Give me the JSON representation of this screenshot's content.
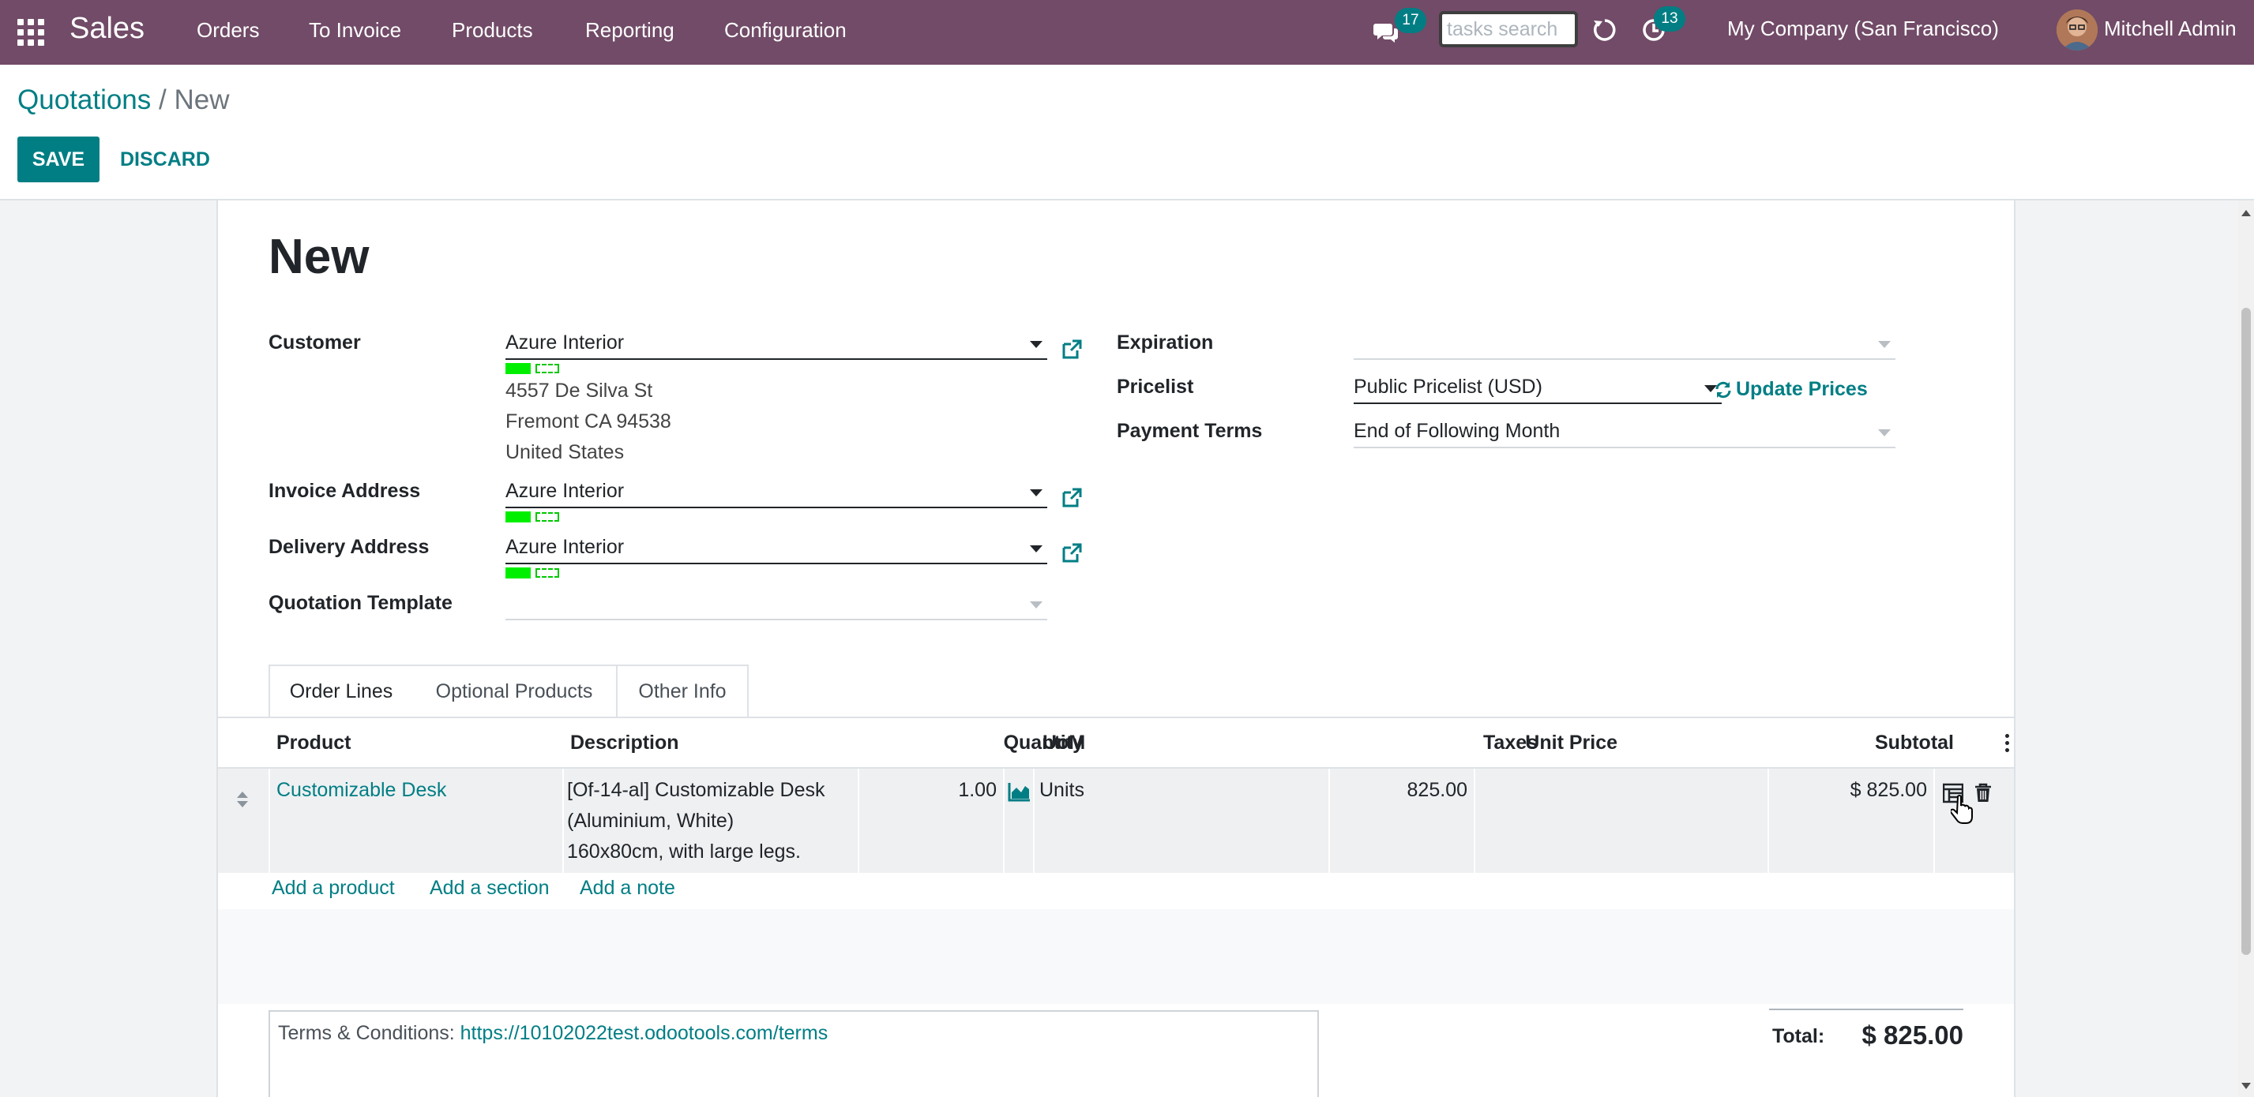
{
  "navbar": {
    "app_name": "Sales",
    "menu": [
      "Orders",
      "To Invoice",
      "Products",
      "Reporting",
      "Configuration"
    ],
    "chat_count": "17",
    "search_placeholder": "tasks search",
    "activity_count": "13",
    "company": "My Company (San Francisco)",
    "user": "Mitchell Admin"
  },
  "breadcrumb": {
    "parent": "Quotations",
    "separator": "/",
    "current": "New"
  },
  "actions": {
    "save": "SAVE",
    "discard": "DISCARD"
  },
  "form": {
    "title": "New",
    "customer": {
      "label": "Customer",
      "value": "Azure Interior",
      "address": [
        "4557 De Silva St",
        "Fremont CA 94538",
        "United States"
      ]
    },
    "invoice_address": {
      "label": "Invoice Address",
      "value": "Azure Interior"
    },
    "delivery_address": {
      "label": "Delivery Address",
      "value": "Azure Interior"
    },
    "quotation_template": {
      "label": "Quotation Template",
      "value": ""
    },
    "expiration": {
      "label": "Expiration",
      "value": ""
    },
    "pricelist": {
      "label": "Pricelist",
      "value": "Public Pricelist (USD)",
      "update_label": "Update Prices"
    },
    "payment_terms": {
      "label": "Payment Terms",
      "value": "End of Following Month"
    }
  },
  "tabs": [
    "Order Lines",
    "Optional Products",
    "Other Info"
  ],
  "active_tab": "Order Lines",
  "order_lines": {
    "columns": [
      "Product",
      "Description",
      "Quantity",
      "UoM",
      "Unit Price",
      "Taxes",
      "Subtotal"
    ],
    "rows": [
      {
        "product": "Customizable Desk",
        "description": [
          "[Of-14-al] Customizable Desk",
          "(Aluminium, White)",
          "160x80cm, with large legs."
        ],
        "quantity": "1.00",
        "uom": "Units",
        "unit_price": "825.00",
        "taxes": "",
        "subtotal": "$ 825.00"
      }
    ],
    "add_product": "Add a product",
    "add_section": "Add a section",
    "add_note": "Add a note"
  },
  "terms": {
    "prefix": "Terms & Conditions: ",
    "url": "https://10102022test.odootools.com/terms"
  },
  "totals": {
    "label": "Total:",
    "value": "$ 825.00"
  },
  "colors": {
    "brand": "#714b67",
    "accent": "#017e84",
    "marker": "#00ef00"
  },
  "icons": [
    "apps-grid-icon",
    "chat-icon",
    "refresh-icon",
    "activity-clock-icon",
    "external-link-icon",
    "sync-prices-icon",
    "drag-handle-icon",
    "forecast-chart-icon",
    "line-details-icon",
    "trash-icon",
    "optional-columns-icon",
    "hand-cursor-icon"
  ]
}
